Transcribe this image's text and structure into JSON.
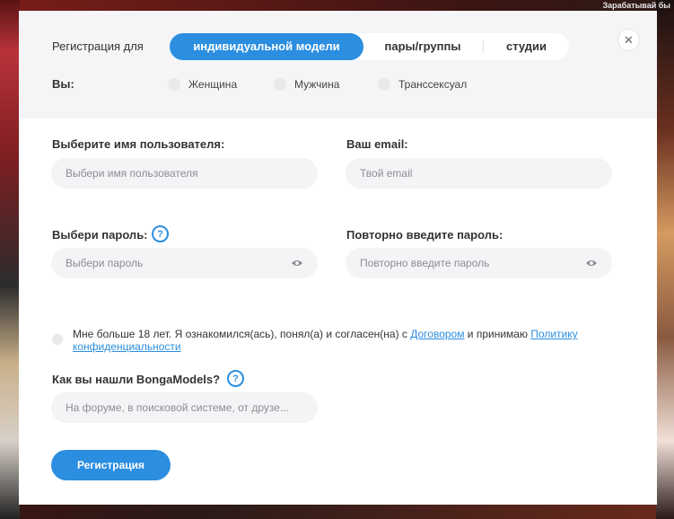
{
  "background": {
    "corner_text": "Зарабатывай бы"
  },
  "modal": {
    "close_icon": "close-icon",
    "register_for_label": "Регистрация для",
    "segments": [
      {
        "label": "индивидуальной модели",
        "active": true
      },
      {
        "label": "пары/группы",
        "active": false
      },
      {
        "label": "студии",
        "active": false
      }
    ],
    "you_label": "Вы:",
    "gender_options": [
      "Женщина",
      "Мужчина",
      "Транссексуал"
    ],
    "username": {
      "label": "Выберите имя пользователя:",
      "placeholder": "Выбери имя пользователя",
      "value": ""
    },
    "email": {
      "label": "Ваш email:",
      "placeholder": "Твой email",
      "value": ""
    },
    "password": {
      "label": "Выбери пароль:",
      "placeholder": "Выбери пароль",
      "value": ""
    },
    "password_repeat": {
      "label": "Повторно введите пароль:",
      "placeholder": "Повторно введите пароль",
      "value": ""
    },
    "agreement": {
      "text_1": "Мне больше 18 лет. Я ознакомился(ась), понял(а) и согласен(на) с ",
      "link_1": "Договором",
      "text_2": " и принимаю ",
      "link_2": "Политику конфиденциальности"
    },
    "referral": {
      "label": "Как вы нашли BongaModels?",
      "placeholder": "На форуме, в поисковой системе, от друзе...",
      "value": ""
    },
    "submit_label": "Регистрация",
    "accent_color": "#2b8ee0"
  }
}
